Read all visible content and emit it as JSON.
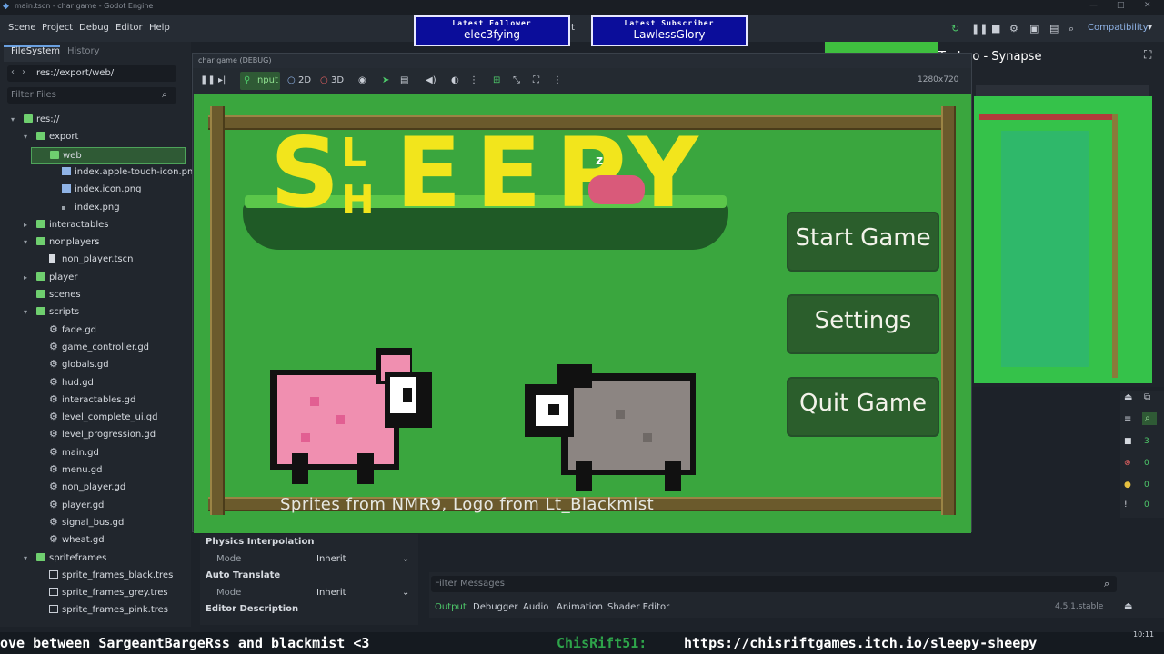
{
  "window": {
    "title": "main.tscn - char game - Godot Engine",
    "controls": [
      "—",
      "□",
      "✕"
    ]
  },
  "menubar": {
    "items": [
      "Scene",
      "Project",
      "Debug",
      "Editor",
      "Help"
    ],
    "renderer": "Compatibility"
  },
  "overlay": {
    "latest_follower_label": "Latest Follower",
    "latest_follower": "elec3fying",
    "latest_subscriber_label": "Latest Subscriber",
    "latest_subscriber": "LawlessGlory",
    "now_playing": "Techno - Synapse",
    "partial_letter": "t"
  },
  "filesystem": {
    "tabs": [
      "FileSystem",
      "History"
    ],
    "path": "res://export/web/",
    "filter_placeholder": "Filter Files",
    "tree": [
      {
        "label": "res://",
        "depth": 0,
        "type": "folder",
        "expanded": true
      },
      {
        "label": "export",
        "depth": 1,
        "type": "folder",
        "expanded": true
      },
      {
        "label": "web",
        "depth": 2,
        "type": "folder",
        "selected": true
      },
      {
        "label": "index.apple-touch-icon.png",
        "depth": 3,
        "type": "image"
      },
      {
        "label": "index.icon.png",
        "depth": 3,
        "type": "image"
      },
      {
        "label": "index.png",
        "depth": 3,
        "type": "file"
      },
      {
        "label": "interactables",
        "depth": 1,
        "type": "folder",
        "expanded": false
      },
      {
        "label": "nonplayers",
        "depth": 1,
        "type": "folder",
        "expanded": true
      },
      {
        "label": "non_player.tscn",
        "depth": 2,
        "type": "scene"
      },
      {
        "label": "player",
        "depth": 1,
        "type": "folder",
        "expanded": false
      },
      {
        "label": "scenes",
        "depth": 1,
        "type": "folder"
      },
      {
        "label": "scripts",
        "depth": 1,
        "type": "folder",
        "expanded": true
      },
      {
        "label": "fade.gd",
        "depth": 2,
        "type": "script"
      },
      {
        "label": "game_controller.gd",
        "depth": 2,
        "type": "script"
      },
      {
        "label": "globals.gd",
        "depth": 2,
        "type": "script"
      },
      {
        "label": "hud.gd",
        "depth": 2,
        "type": "script"
      },
      {
        "label": "interactables.gd",
        "depth": 2,
        "type": "script"
      },
      {
        "label": "level_complete_ui.gd",
        "depth": 2,
        "type": "script"
      },
      {
        "label": "level_progression.gd",
        "depth": 2,
        "type": "script"
      },
      {
        "label": "main.gd",
        "depth": 2,
        "type": "script"
      },
      {
        "label": "menu.gd",
        "depth": 2,
        "type": "script"
      },
      {
        "label": "non_player.gd",
        "depth": 2,
        "type": "script"
      },
      {
        "label": "player.gd",
        "depth": 2,
        "type": "script"
      },
      {
        "label": "signal_bus.gd",
        "depth": 2,
        "type": "script"
      },
      {
        "label": "wheat.gd",
        "depth": 2,
        "type": "script"
      },
      {
        "label": "spriteframes",
        "depth": 1,
        "type": "folder",
        "expanded": true
      },
      {
        "label": "sprite_frames_black.tres",
        "depth": 2,
        "type": "resource"
      },
      {
        "label": "sprite_frames_grey.tres",
        "depth": 2,
        "type": "resource"
      },
      {
        "label": "sprite_frames_pink.tres",
        "depth": 2,
        "type": "resource"
      }
    ]
  },
  "inspector": {
    "physics_interpolation": "Physics Interpolation",
    "mode_label": "Mode",
    "mode_value": "Inherit",
    "auto_translate": "Auto Translate",
    "mode2_label": "Mode",
    "mode2_value": "Inherit",
    "editor_description": "Editor Description"
  },
  "game_window": {
    "title": "char game (DEBUG)",
    "input_label": "Input",
    "mode_2d": "2D",
    "mode_3d": "3D",
    "resolution": "1280x720"
  },
  "game": {
    "logo_letters": [
      "S",
      "L",
      "H",
      "E",
      "E",
      "P",
      "Y"
    ],
    "sleep_mark": "z",
    "buttons": [
      "Start Game",
      "Settings",
      "Quit Game"
    ],
    "credits": "Sprites from NMR9, Logo from Lt_Blackmist"
  },
  "output": {
    "filter_placeholder": "Filter Messages",
    "tabs": [
      "Output",
      "Debugger",
      "Audio",
      "Animation",
      "Shader Editor"
    ],
    "version": "4.5.1.stable",
    "counts": [
      "3",
      "0",
      "0",
      "0"
    ]
  },
  "ticker": {
    "text1": "ove between SargeantBargeRss and blackmist <3",
    "user": "ChisRift51:",
    "text2": "https://chisriftgames.itch.io/sleepy-sheepy",
    "clock": "10:11"
  },
  "colors": {
    "accent": "#4ea35a",
    "grass": "#3aa63e",
    "logo": "#f2e51c",
    "button": "#2b5e2c"
  }
}
